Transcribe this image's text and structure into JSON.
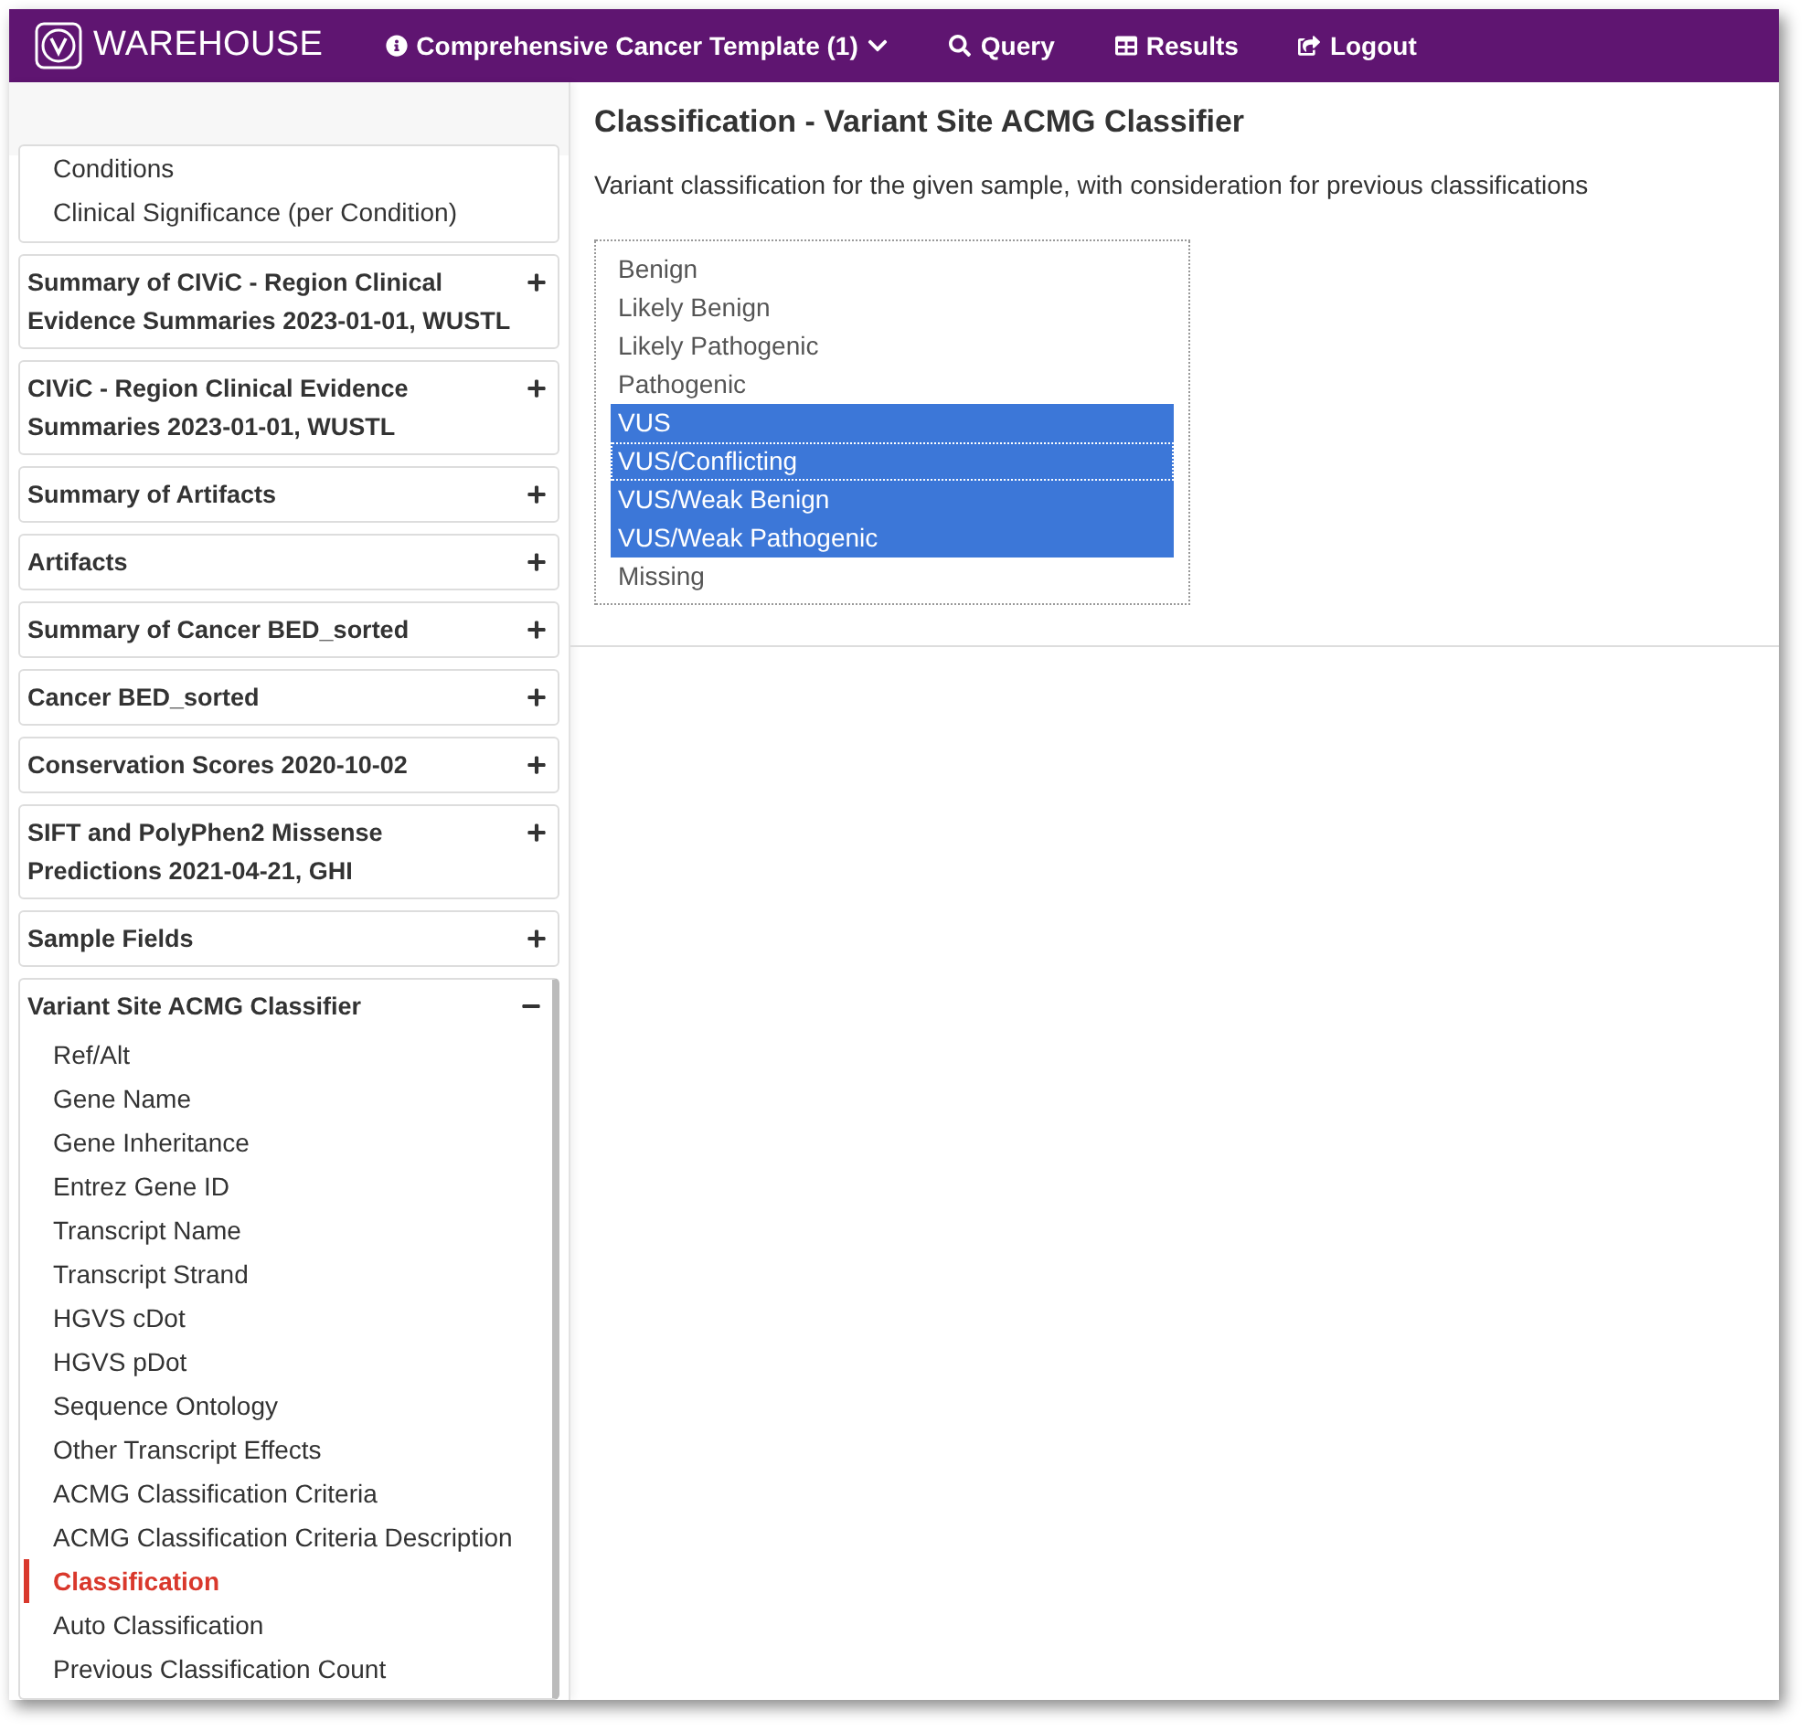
{
  "navbar": {
    "brand": "WAREHOUSE",
    "items": [
      {
        "kind": "info",
        "label": "Comprehensive Cancer Template (1)",
        "dropdown": true
      },
      {
        "kind": "search",
        "label": "Query",
        "dropdown": false
      },
      {
        "kind": "table",
        "label": "Results",
        "dropdown": false
      },
      {
        "kind": "logout",
        "label": "Logout",
        "dropdown": false
      }
    ]
  },
  "sidebar": {
    "panels": [
      {
        "items": [
          {
            "label": "Conditions",
            "selected": false
          },
          {
            "label": "Clinical Significance (per Condition)",
            "selected": false
          }
        ]
      },
      {
        "title": "Summary of CIViC - Region Clinical Evidence Summaries 2023-01-01, WUSTL",
        "expanded": false
      },
      {
        "title": "CIViC - Region Clinical Evidence Summaries 2023-01-01, WUSTL",
        "expanded": false
      },
      {
        "title": "Summary of Artifacts",
        "expanded": false
      },
      {
        "title": "Artifacts",
        "expanded": false
      },
      {
        "title": "Summary of Cancer BED_sorted",
        "expanded": false
      },
      {
        "title": "Cancer BED_sorted",
        "expanded": false
      },
      {
        "title": "Conservation Scores 2020-10-02",
        "expanded": false
      },
      {
        "title": "SIFT and PolyPhen2 Missense Predictions 2021-04-21, GHI",
        "expanded": false
      },
      {
        "title": "Sample Fields",
        "expanded": false
      },
      {
        "title": "Variant Site ACMG Classifier",
        "expanded": true,
        "items": [
          {
            "label": "Ref/Alt",
            "selected": false
          },
          {
            "label": "Gene Name",
            "selected": false
          },
          {
            "label": "Gene Inheritance",
            "selected": false
          },
          {
            "label": "Entrez Gene ID",
            "selected": false
          },
          {
            "label": "Transcript Name",
            "selected": false
          },
          {
            "label": "Transcript Strand",
            "selected": false
          },
          {
            "label": "HGVS cDot",
            "selected": false
          },
          {
            "label": "HGVS pDot",
            "selected": false
          },
          {
            "label": "Sequence Ontology",
            "selected": false
          },
          {
            "label": "Other Transcript Effects",
            "selected": false
          },
          {
            "label": "ACMG Classification Criteria",
            "selected": false
          },
          {
            "label": "ACMG Classification Criteria Description",
            "selected": false
          },
          {
            "label": "Classification",
            "selected": true
          },
          {
            "label": "Auto Classification",
            "selected": false
          },
          {
            "label": "Previous Classification Count",
            "selected": false
          }
        ]
      }
    ]
  },
  "main": {
    "title": "Classification - Variant Site ACMG Classifier",
    "description": "Variant classification for the given sample, with consideration for previous classifications",
    "listbox": {
      "options": [
        {
          "label": "Benign",
          "selected": false,
          "focused": false
        },
        {
          "label": "Likely Benign",
          "selected": false,
          "focused": false
        },
        {
          "label": "Likely Pathogenic",
          "selected": false,
          "focused": false
        },
        {
          "label": "Pathogenic",
          "selected": false,
          "focused": false
        },
        {
          "label": "VUS",
          "selected": true,
          "focused": false
        },
        {
          "label": "VUS/Conflicting",
          "selected": true,
          "focused": true
        },
        {
          "label": "VUS/Weak Benign",
          "selected": true,
          "focused": false
        },
        {
          "label": "VUS/Weak Pathogenic",
          "selected": true,
          "focused": false
        },
        {
          "label": "Missing",
          "selected": false,
          "focused": false
        }
      ]
    }
  }
}
